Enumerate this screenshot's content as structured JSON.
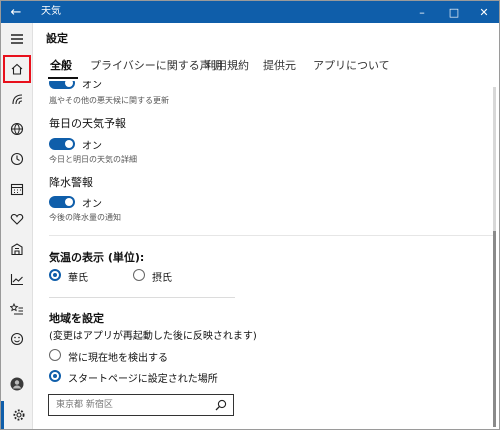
{
  "window": {
    "title": "天気",
    "back_icon": "back-arrow-icon",
    "title_color": "#0f5eaa"
  },
  "header": {
    "title": "設定",
    "tabs": [
      {
        "label": "全般",
        "active": true
      },
      {
        "label": "プライバシーに関する声明",
        "active": false
      },
      {
        "label": "利用規約",
        "active": false
      },
      {
        "label": "提供元",
        "active": false
      },
      {
        "label": "アプリについて",
        "active": false
      }
    ]
  },
  "rail": {
    "items": [
      "hamburger-menu-icon",
      "home-icon",
      "news-icon",
      "globe-icon",
      "clock-icon",
      "calendar-icon",
      "heart-icon",
      "building-icon",
      "chart-icon",
      "star-list-icon",
      "smiley-icon",
      "account-icon",
      "settings-icon"
    ],
    "highlight_color": "#e8101c"
  },
  "content": {
    "alerts": {
      "toggle_text": "オン",
      "desc": "嵐やその他の悪天候に関する更新"
    },
    "daily_forecast": {
      "label": "毎日の天気予報",
      "toggle_text": "オン",
      "desc": "今日と明日の天気の詳細"
    },
    "precip": {
      "label": "降水警報",
      "toggle_text": "オン",
      "desc": "今後の降水量の通知"
    },
    "temperature": {
      "label": "気温の表示 (単位):",
      "options": [
        {
          "label": "華氏",
          "checked": true
        },
        {
          "label": "摂氏",
          "checked": false
        }
      ]
    },
    "location": {
      "label": "地域を設定",
      "note": "(変更はアプリが再起動した後に反映されます)",
      "options": [
        {
          "label": "常に現在地を検出する",
          "checked": false
        },
        {
          "label": "スタートページに設定された場所",
          "checked": true
        }
      ],
      "search_value": "東京都 新宿区"
    }
  },
  "colors": {
    "accent": "#0f5eaa"
  }
}
